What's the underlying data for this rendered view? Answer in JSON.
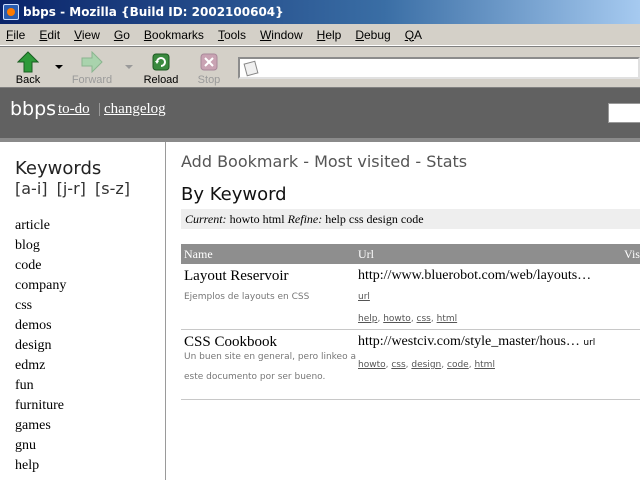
{
  "window": {
    "title": "bbps - Mozilla {Build ID: 2002100604}"
  },
  "menu": [
    "File",
    "Edit",
    "View",
    "Go",
    "Bookmarks",
    "Tools",
    "Window",
    "Help",
    "Debug",
    "QA"
  ],
  "toolbar": {
    "back": "Back",
    "forward": "Forward",
    "reload": "Reload",
    "stop": "Stop",
    "url": ""
  },
  "site": {
    "title": "bbps",
    "links": [
      "to-do",
      "changelog"
    ]
  },
  "sidebar": {
    "title": "Keywords",
    "ranges": [
      "[a-i]",
      "[j-r]",
      "[s-z]"
    ],
    "keywords": [
      "article",
      "blog",
      "code",
      "company",
      "css",
      "demos",
      "design",
      "edmz",
      "fun",
      "furniture",
      "games",
      "gnu",
      "help"
    ]
  },
  "main": {
    "nav": [
      "Add Bookmark",
      "Most visited",
      "Stats"
    ],
    "nav_sep": " - ",
    "heading": "By Keyword",
    "current_label": "Current:",
    "current_value": "howto html",
    "refine_label": "Refine:",
    "refine_value": "help css design code",
    "columns": [
      "Name",
      "Url",
      "Vis"
    ],
    "bookmarks": [
      {
        "name": "Layout Reservoir",
        "description": "Ejemplos de layouts en CSS",
        "url": "http://www.bluerobot.com/web/layouts…",
        "url_link": "url",
        "tags": [
          "help",
          "howto",
          "css",
          "html"
        ]
      },
      {
        "name": "CSS Cookbook",
        "description": "Un buen site en general, pero linkeo a este documento por ser bueno.",
        "url": "http://westciv.com/style_master/hous…",
        "url_link": "url",
        "tags": [
          "howto",
          "css",
          "design",
          "code",
          "html"
        ]
      }
    ]
  }
}
